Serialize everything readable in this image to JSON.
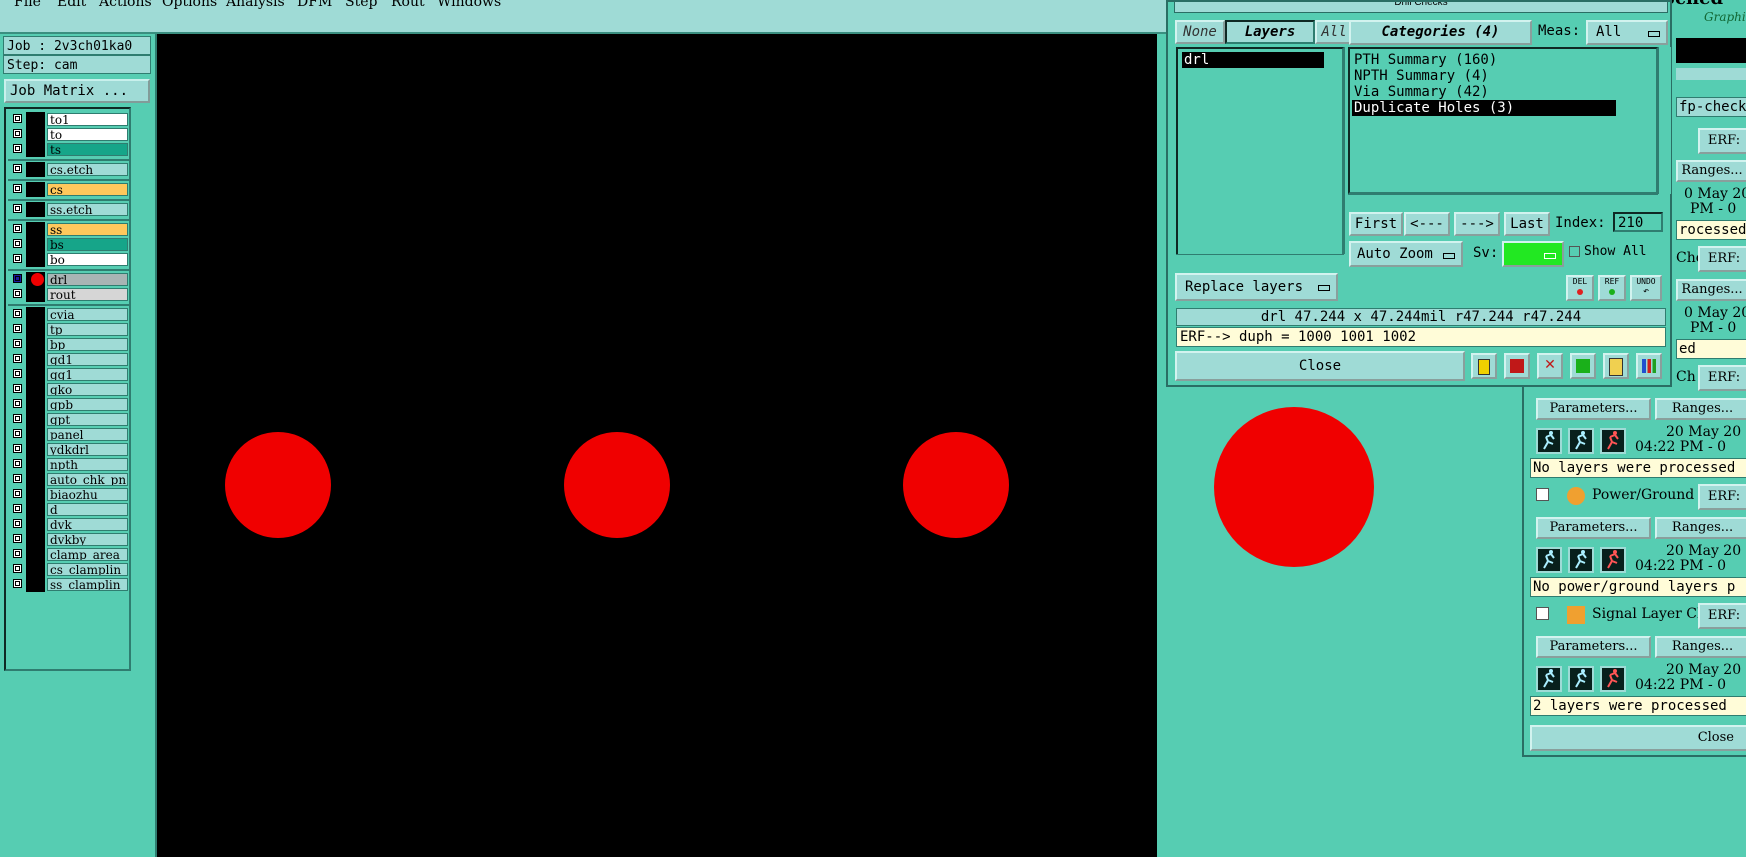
{
  "menu": [
    "File",
    "Edit",
    "Actions",
    "Options",
    "Analysis",
    "DFM",
    "Step",
    "Rout",
    "Windows"
  ],
  "job": {
    "job_label": "Job : 2v3ch01ka0",
    "step_label": "Step: cam",
    "matrix_button": "Job Matrix ..."
  },
  "layers": [
    {
      "name": "to1",
      "color": "#ffffff",
      "group": 1
    },
    {
      "name": "to",
      "color": "#ffffff",
      "group": 1
    },
    {
      "name": "ts",
      "color": "#16a589",
      "group": 1
    },
    {
      "name": "cs.etch",
      "color": "#9fdbd6",
      "group": 2
    },
    {
      "name": "cs",
      "color": "#ffc85c",
      "group": 3
    },
    {
      "name": "ss.etch",
      "color": "#9fdbd6",
      "group": 4
    },
    {
      "name": "ss",
      "color": "#ffc85c",
      "group": 5
    },
    {
      "name": "bs",
      "color": "#16a589",
      "group": 5
    },
    {
      "name": "bo",
      "color": "#ffffff",
      "group": 5
    },
    {
      "name": "drl",
      "color": "#a8b4b4",
      "group": 6,
      "active": true
    },
    {
      "name": "rout",
      "color": "#d6d6d6",
      "group": 6
    },
    {
      "name": "cvia",
      "color": "#9fdbd6",
      "group": 7
    },
    {
      "name": "tp",
      "color": "#9fdbd6",
      "group": 7
    },
    {
      "name": "bp",
      "color": "#9fdbd6",
      "group": 7
    },
    {
      "name": "gd1",
      "color": "#9fdbd6",
      "group": 7
    },
    {
      "name": "gg1",
      "color": "#9fdbd6",
      "group": 7
    },
    {
      "name": "gko",
      "color": "#9fdbd6",
      "group": 7
    },
    {
      "name": "gpb",
      "color": "#9fdbd6",
      "group": 7
    },
    {
      "name": "gpt",
      "color": "#9fdbd6",
      "group": 7
    },
    {
      "name": "panel",
      "color": "#9fdbd6",
      "group": 7
    },
    {
      "name": "ydkdrl",
      "color": "#9fdbd6",
      "group": 7
    },
    {
      "name": "npth",
      "color": "#9fdbd6",
      "group": 7
    },
    {
      "name": "auto_chk_pn_",
      "color": "#9fdbd6",
      "group": 7
    },
    {
      "name": "biaozhu",
      "color": "#9fdbd6",
      "group": 7
    },
    {
      "name": "d",
      "color": "#9fdbd6",
      "group": 7
    },
    {
      "name": "dvk",
      "color": "#9fdbd6",
      "group": 7
    },
    {
      "name": "dvkby",
      "color": "#9fdbd6",
      "group": 7
    },
    {
      "name": "clamp_area",
      "color": "#9fdbd6",
      "group": 7
    },
    {
      "name": "cs_clamplin",
      "color": "#9fdbd6",
      "group": 7
    },
    {
      "name": "ss_clamplin",
      "color": "#9fdbd6",
      "group": 7
    }
  ],
  "drill_window": {
    "title": "Drill Checks",
    "none_btn": "None",
    "layers_btn": "Layers",
    "all_btn": "All",
    "layers": [
      "drl"
    ],
    "categories_label": "Categories (4)",
    "meas_label": "Meas:",
    "meas_value": "All",
    "categories": [
      "PTH Summary (160)",
      "NPTH Summary (4)",
      "Via Summary (42)",
      "Duplicate Holes (3)"
    ],
    "selected_category": 3,
    "nav": {
      "first": "First",
      "prev": "<---",
      "next": "--->",
      "last": "Last",
      "index_label": "Index:",
      "index_value": "210"
    },
    "auto_zoom": "Auto Zoom",
    "sv_label": "Sv:",
    "show_all": "Show All",
    "replace_layers": "Replace layers",
    "small_icons": [
      "DEL",
      "REF",
      "UNDO"
    ],
    "status_line": "drl 47.244 x 47.244mil  r47.244  r47.244",
    "erf_line": "ERF--> duph = 1000 1001 1002",
    "close": "Close"
  },
  "checklist": {
    "header1": "Sched",
    "header2": "Graphic",
    "fp_label": "fp-checkli",
    "erf": "ERF:",
    "ranges": "Ranges...",
    "parameters": "Parameters...",
    "cut_date_1": "0 May 20",
    "cut_time_1": "PM - 0",
    "cut_msg_1": "rocessed",
    "cut_ch": "Che",
    "cut_date_2": "0 May 20",
    "cut_time_2": "PM - 0",
    "cut_msg_2": "ed",
    "cut_ch2": "Ch",
    "date_full": "20 May 20",
    "time_full": "04:22 PM - 0",
    "msg_a": "No layers were processed",
    "power_title": "Power/Ground C",
    "msg_b": "No power/ground layers p",
    "signal_title": "Signal Layer Ch",
    "msg_c": "2 layers were processed",
    "close": "Close"
  },
  "colors": {
    "canvas": "#000000",
    "pad": "#f00000",
    "panel": "#56cdb2",
    "button": "#9fdbd6",
    "selection": "#000000",
    "sv_green": "#22e822"
  }
}
